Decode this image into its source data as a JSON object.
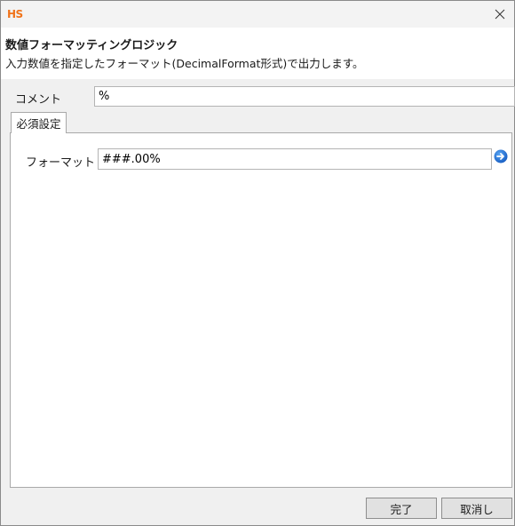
{
  "titlebar": {
    "app_logo": "HS",
    "close_icon": "close-icon"
  },
  "header": {
    "title": "数値フォーマッティングロジック",
    "description": "入力数値を指定したフォーマット(DecimalFormat形式)で出力します。"
  },
  "form": {
    "comment_label": "コメント",
    "comment_value": "%"
  },
  "tabs": [
    {
      "label": "必須設定"
    }
  ],
  "panel": {
    "format_label": "フォーマット",
    "format_value": "###.00%",
    "go_icon": "arrow-right-circle-icon"
  },
  "buttons": {
    "ok_label": "完了",
    "cancel_label": "取消し"
  },
  "colors": {
    "logo": "#f0731a",
    "go_icon": "#1e6fd9"
  }
}
